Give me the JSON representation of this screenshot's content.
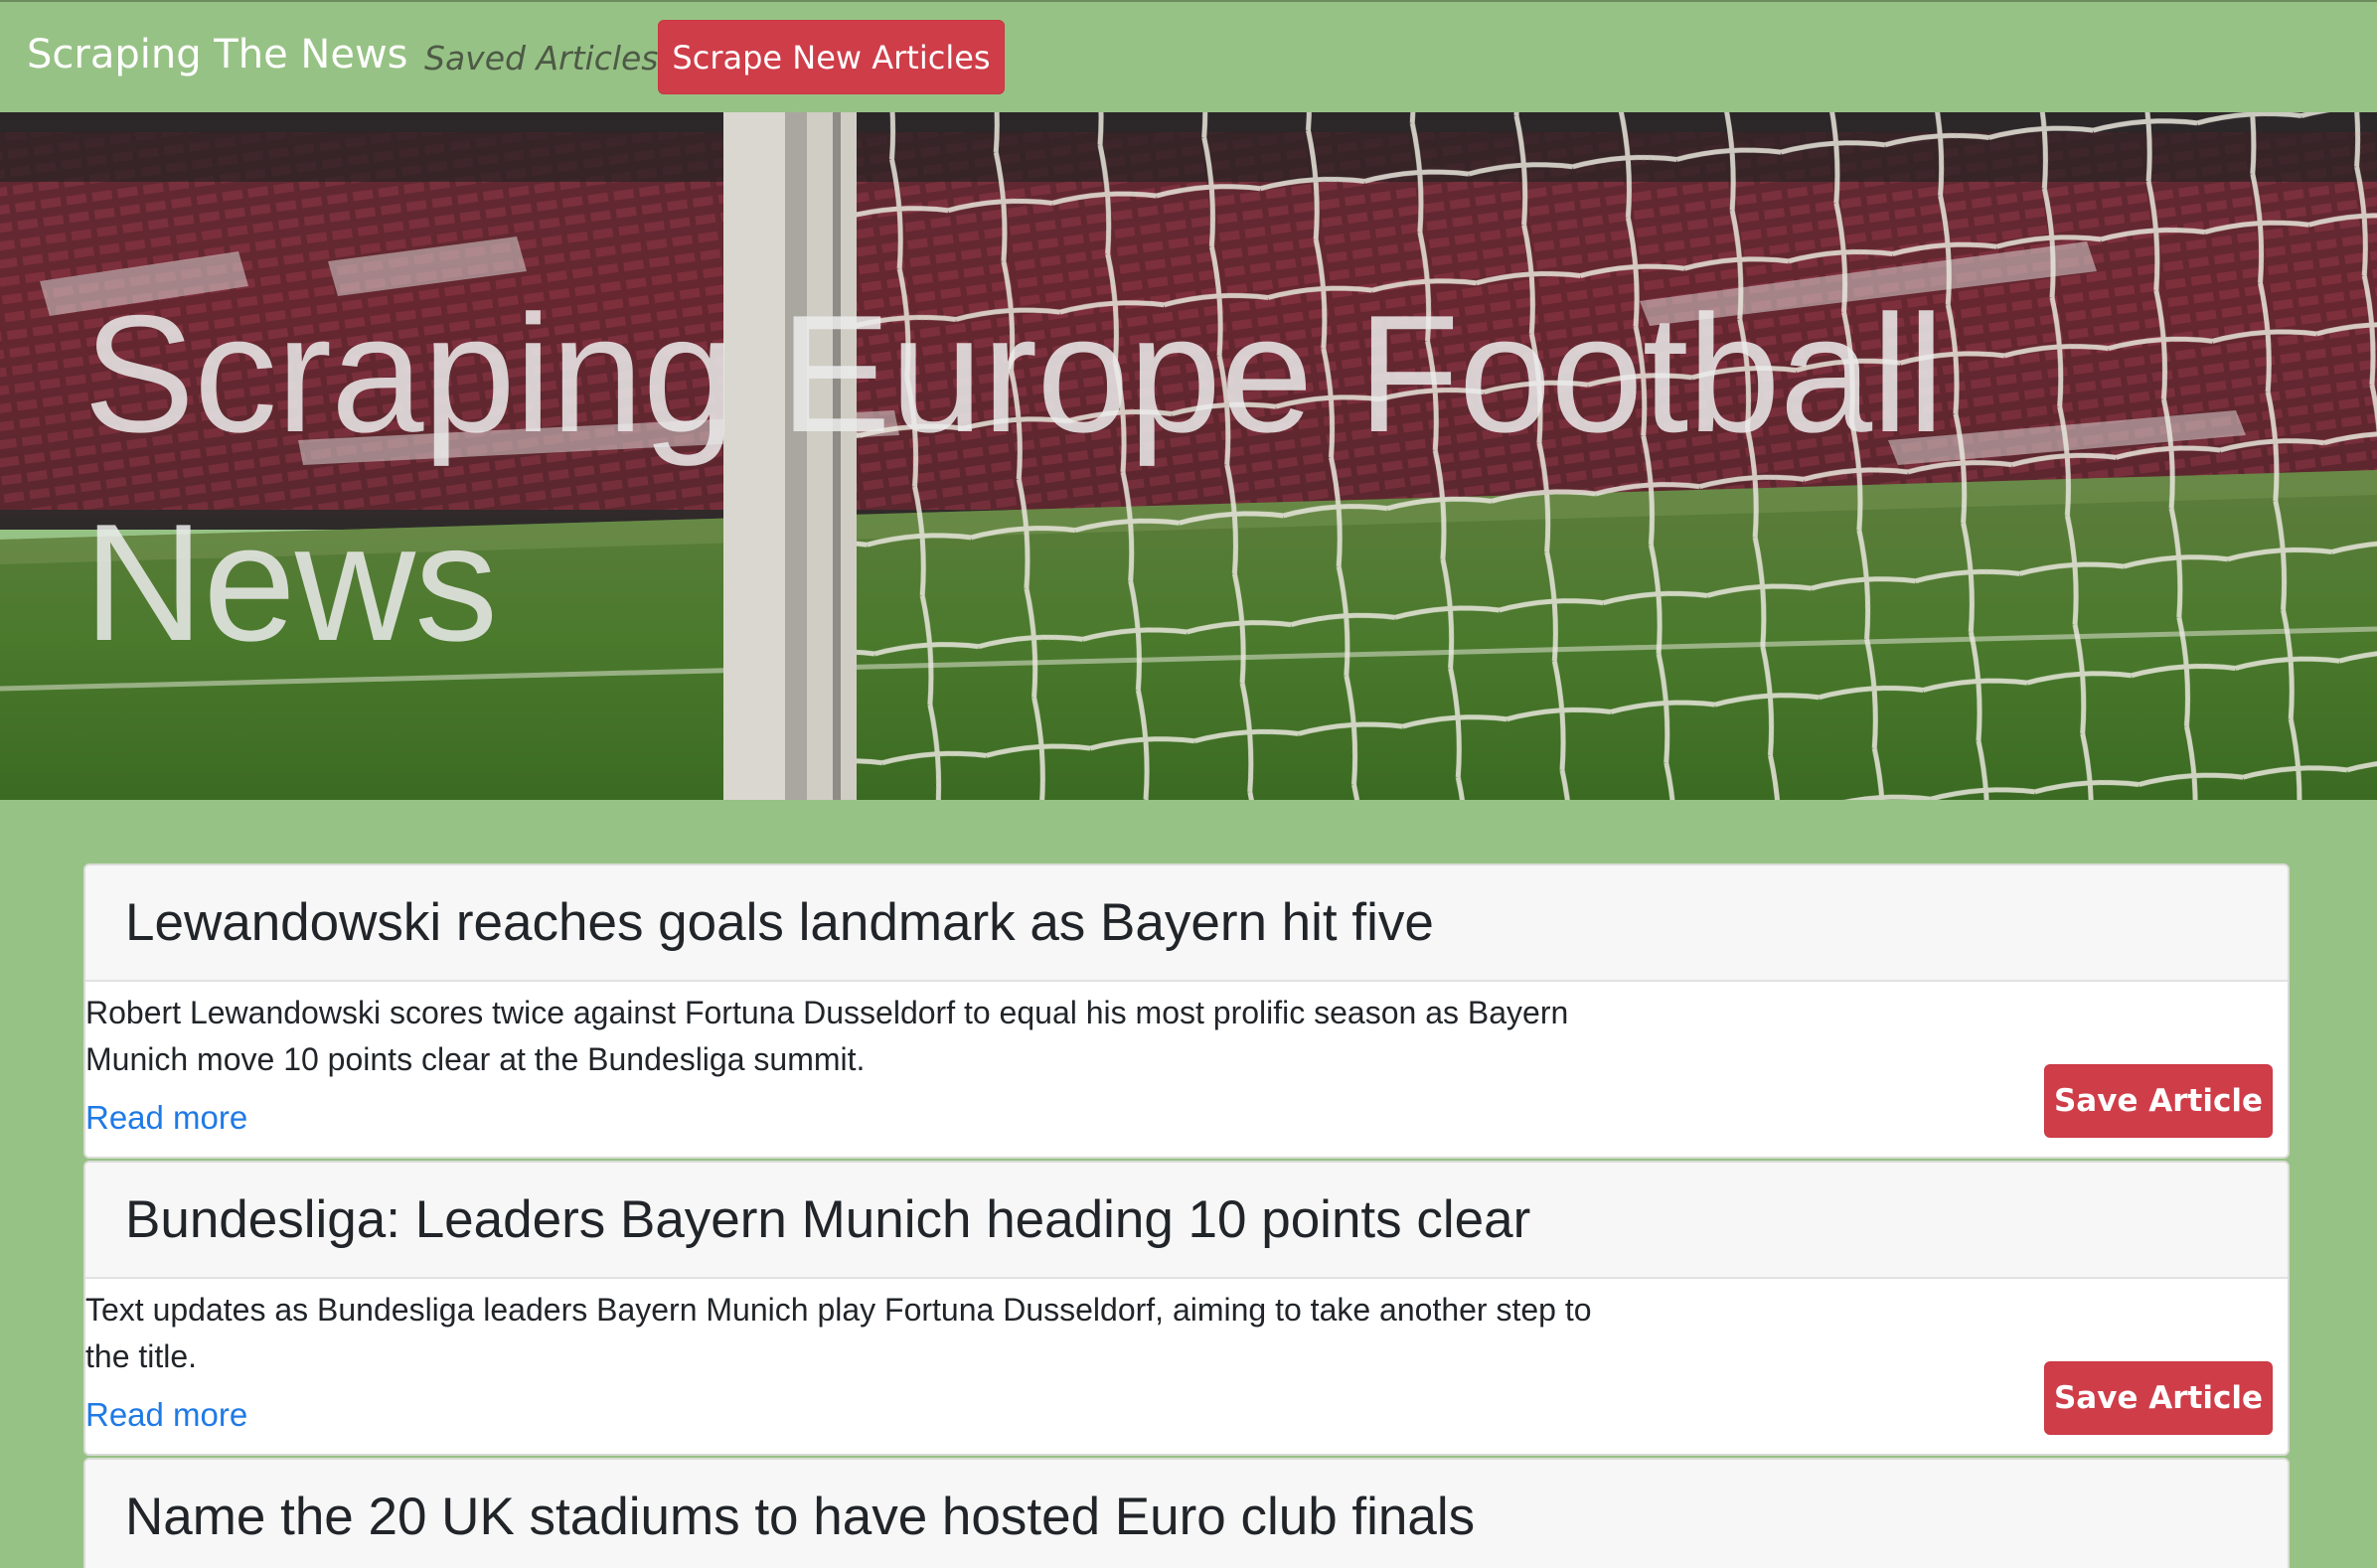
{
  "navbar": {
    "brand": "Scraping The News",
    "saved_link": "Saved Articles",
    "scrape_button": "Scrape New Articles"
  },
  "hero": {
    "title": "Scraping Europe Football News"
  },
  "articles": [
    {
      "title": "Lewandowski reaches goals landmark as Bayern hit five",
      "summary": "Robert Lewandowski scores twice against Fortuna Dusseldorf to equal his most prolific season as Bayern Munich move 10 points clear at the Bundesliga summit.",
      "link_label": "Read more",
      "save_label": "Save Article"
    },
    {
      "title": "Bundesliga: Leaders Bayern Munich heading 10 points clear",
      "summary": "Text updates as Bundesliga leaders Bayern Munich play Fortuna Dusseldorf, aiming to take another step to the title.",
      "link_label": "Read more",
      "save_label": "Save Article"
    },
    {
      "title": "Name the 20 UK stadiums to have hosted Euro club finals"
    }
  ],
  "colors": {
    "page_background": "#97c285",
    "button_red": "#cf3d49",
    "link_blue": "#1f7ae6"
  }
}
